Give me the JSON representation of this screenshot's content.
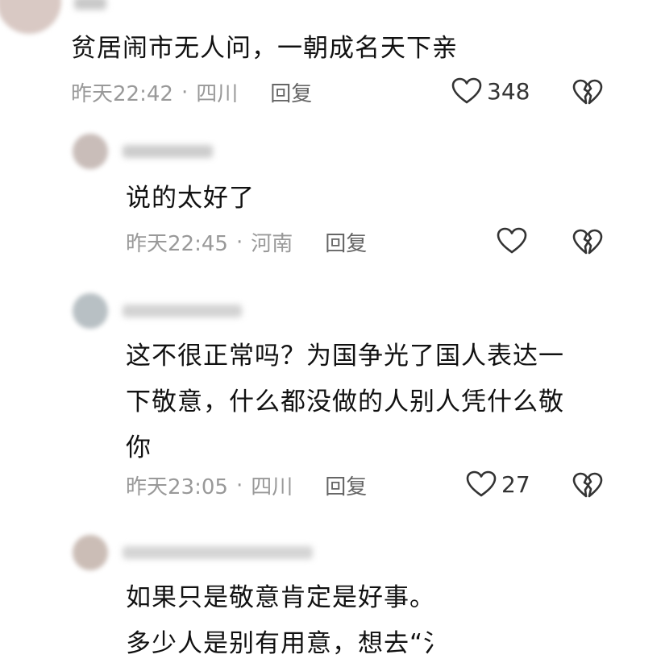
{
  "comments": [
    {
      "text": "贫居闹市无人问，一朝成名天下亲",
      "time": "昨天22:42",
      "region": "四川",
      "reply_label": "回复",
      "likes": "348"
    },
    {
      "text": "说的太好了",
      "time": "昨天22:45",
      "region": "河南",
      "reply_label": "回复",
      "likes": ""
    },
    {
      "text": "这不很正常吗？为国争光了国人表达一\n下敬意，什么都没做的人别人凭什么敬\n你",
      "time": "昨天23:05",
      "region": "四川",
      "reply_label": "回复",
      "likes": "27"
    },
    {
      "text": "如果只是敬意肯定是好事。\n多少人是别有用意，想去“氵"
    }
  ],
  "meta_separator": "·",
  "icons": {
    "like": "heart-outline-icon",
    "dislike": "broken-heart-icon"
  },
  "colors": {
    "text": "#111111",
    "meta": "#999999",
    "icon": "#333333"
  }
}
